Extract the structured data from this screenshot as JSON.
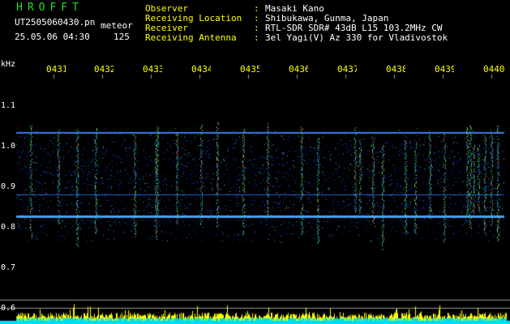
{
  "header": {
    "logo": "HROFFT",
    "file_name": "UT2505060430.pn",
    "meteor_label": "meteor",
    "date_time": "25.05.06 04:30",
    "count": "125"
  },
  "info": [
    {
      "label": "Observer",
      "value": "Masaki Kano"
    },
    {
      "label": "Receiving Location",
      "value": "Shibukawa, Gunma, Japan"
    },
    {
      "label": "Receiver",
      "value": "RTL-SDR SDR# 43dB L15 103.2MHz CW"
    },
    {
      "label": "Receiving Antenna",
      "value": "3el Yagi(V) Az 330 for Vladivostok"
    }
  ],
  "info_separator": ":",
  "axis": {
    "y_unit": "kHz",
    "y_ticks": [
      "1.1",
      "1.0",
      "0.9",
      "0.8",
      "0.7",
      "0.6"
    ],
    "time_labels": [
      "0431",
      "0432",
      "0433",
      "0434",
      "0435",
      "0436",
      "0437",
      "0438",
      "0439",
      "0440"
    ]
  },
  "colors": {
    "logo": "#22dd22",
    "label_text": "#ffffff",
    "info_label": "#ffff00",
    "info_value": "#ffffff",
    "time_label": "#ffff00",
    "grid": "#9a9a9a",
    "bar_yellow": "#ffff00",
    "bar_cyan": "#00ddee"
  }
}
